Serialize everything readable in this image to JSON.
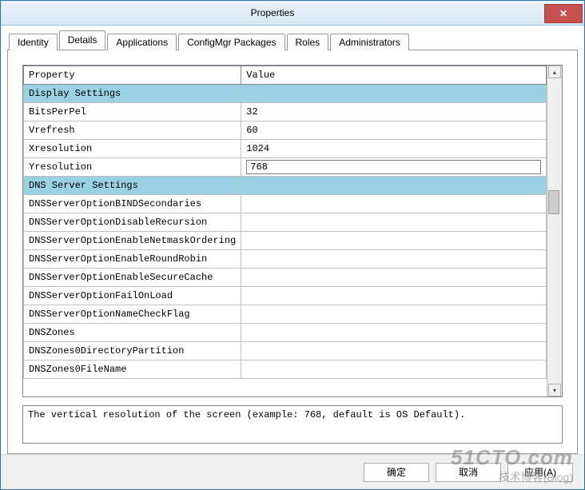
{
  "window": {
    "title": "Properties",
    "close_glyph": "✕"
  },
  "tabs": [
    {
      "label": "Identity",
      "active": false
    },
    {
      "label": "Details",
      "active": true
    },
    {
      "label": "Applications",
      "active": false
    },
    {
      "label": "ConfigMgr Packages",
      "active": false
    },
    {
      "label": "Roles",
      "active": false
    },
    {
      "label": "Administrators",
      "active": false
    }
  ],
  "grid": {
    "header_property": "Property",
    "header_value": "Value",
    "rows": [
      {
        "type": "section",
        "property": "Display Settings",
        "value": ""
      },
      {
        "type": "row",
        "property": "BitsPerPel",
        "value": "32"
      },
      {
        "type": "row",
        "property": "Vrefresh",
        "value": "60"
      },
      {
        "type": "row",
        "property": "Xresolution",
        "value": "1024"
      },
      {
        "type": "row",
        "property": "Yresolution",
        "value": "768",
        "editing": true
      },
      {
        "type": "section",
        "property": "DNS Server Settings",
        "value": ""
      },
      {
        "type": "row",
        "property": "DNSServerOptionBINDSecondaries",
        "value": ""
      },
      {
        "type": "row",
        "property": "DNSServerOptionDisableRecursion",
        "value": ""
      },
      {
        "type": "row",
        "property": "DNSServerOptionEnableNetmaskOrdering",
        "value": ""
      },
      {
        "type": "row",
        "property": "DNSServerOptionEnableRoundRobin",
        "value": ""
      },
      {
        "type": "row",
        "property": "DNSServerOptionEnableSecureCache",
        "value": ""
      },
      {
        "type": "row",
        "property": "DNSServerOptionFailOnLoad",
        "value": ""
      },
      {
        "type": "row",
        "property": "DNSServerOptionNameCheckFlag",
        "value": ""
      },
      {
        "type": "row",
        "property": "DNSZones",
        "value": ""
      },
      {
        "type": "row",
        "property": "DNSZones0DirectoryPartition",
        "value": ""
      },
      {
        "type": "row",
        "property": "DNSZones0FileName",
        "value": ""
      }
    ]
  },
  "help_text": "The vertical resolution of the screen (example: 768, default is OS Default).",
  "buttons": {
    "ok": "确定",
    "cancel": "取消",
    "apply": "应用(A)"
  },
  "watermark": {
    "line1": "51CTO.com",
    "line2": "技术博客(Blog)"
  },
  "scroll": {
    "up_glyph": "▴",
    "down_glyph": "▾"
  }
}
